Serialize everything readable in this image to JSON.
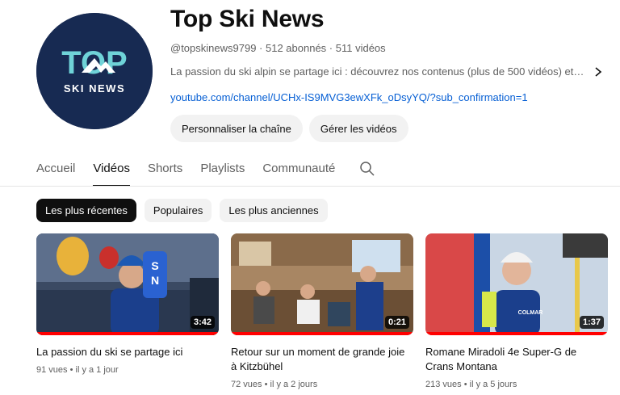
{
  "channel": {
    "name": "Top Ski News",
    "handle": "@topskinews9799",
    "subscribers": "512 abonnés",
    "videos_count": "511 vidéos",
    "separator": " · ",
    "description": "La passion du ski alpin se partage ici : découvrez nos contenus (plus de 500 vidéos) et rejo...",
    "link": "youtube.com/channel/UCHx-IS9MVG3ewXFk_oDsyYQ/?sub_confirmation=1",
    "logo": {
      "top": "TOP",
      "bottom": "SKI NEWS",
      "bg": "#172a52",
      "accent": "#6fd3d8"
    }
  },
  "actions": {
    "customize": "Personnaliser la chaîne",
    "manage": "Gérer les vidéos"
  },
  "tabs": [
    {
      "label": "Accueil",
      "active": false
    },
    {
      "label": "Vidéos",
      "active": true
    },
    {
      "label": "Shorts",
      "active": false
    },
    {
      "label": "Playlists",
      "active": false
    },
    {
      "label": "Communauté",
      "active": false
    }
  ],
  "chips": [
    {
      "label": "Les plus récentes",
      "active": true
    },
    {
      "label": "Populaires",
      "active": false
    },
    {
      "label": "Les plus anciennes",
      "active": false
    }
  ],
  "videos": [
    {
      "title": "La passion du ski se partage ici",
      "views": "91 vues",
      "age": "il y a 1 jour",
      "duration": "3:42",
      "thumb_icon": "ski-racer-interview-thumbnail"
    },
    {
      "title": "Retour sur un moment de grande joie à Kitzbühel",
      "views": "72 vues",
      "age": "il y a 2 jours",
      "duration": "0:21",
      "thumb_icon": "restaurant-celebration-thumbnail"
    },
    {
      "title": "Romane Miradoli 4e Super-G de Crans Montana",
      "views": "213 vues",
      "age": "il y a 5 jours",
      "duration": "1:37",
      "thumb_icon": "athlete-interview-thumbnail"
    }
  ],
  "meta_separator": " • ",
  "colors": {
    "link": "#065fd4",
    "progress": "#ff0000",
    "chip_active": "#0f0f0f",
    "chip": "#f2f2f2"
  }
}
